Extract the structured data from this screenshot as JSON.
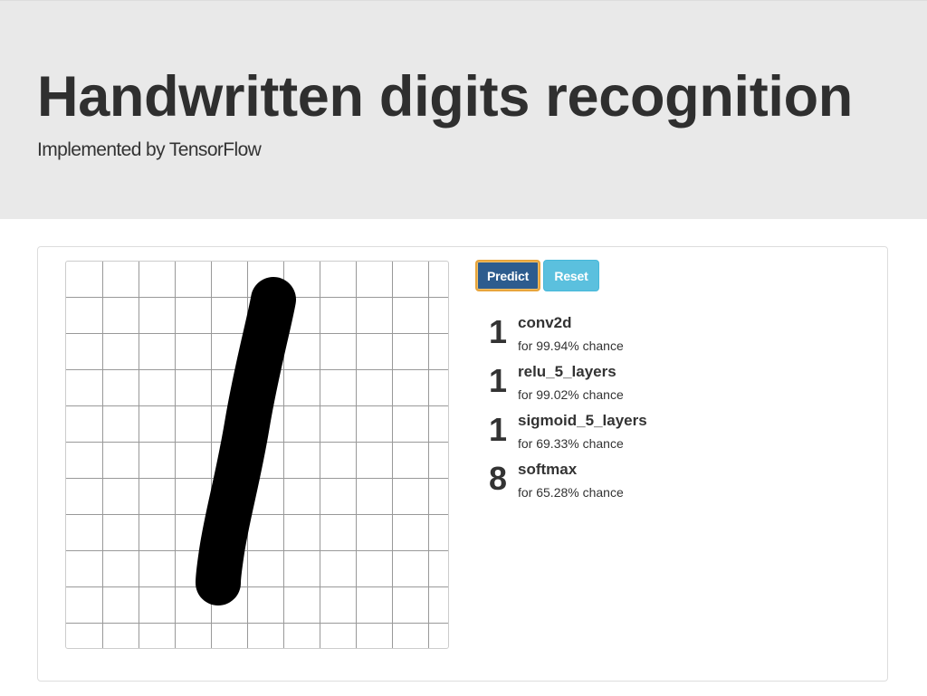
{
  "header": {
    "title": "Handwritten digits recognition",
    "subtitle": "Implemented by TensorFlow"
  },
  "canvas": {
    "grid_color": "#999999",
    "stroke_color": "#000000",
    "drawn_digit_hint": "1"
  },
  "buttons": {
    "predict_label": "Predict",
    "reset_label": "Reset",
    "predict_color": "#2d5c8e",
    "reset_color": "#5bc0de"
  },
  "results": [
    {
      "digit": "1",
      "model": "conv2d",
      "chance": "for 99.94% chance"
    },
    {
      "digit": "1",
      "model": "relu_5_layers",
      "chance": "for 99.02% chance"
    },
    {
      "digit": "1",
      "model": "sigmoid_5_layers",
      "chance": "for 69.33% chance"
    },
    {
      "digit": "8",
      "model": "softmax",
      "chance": "for 65.28% chance"
    }
  ]
}
